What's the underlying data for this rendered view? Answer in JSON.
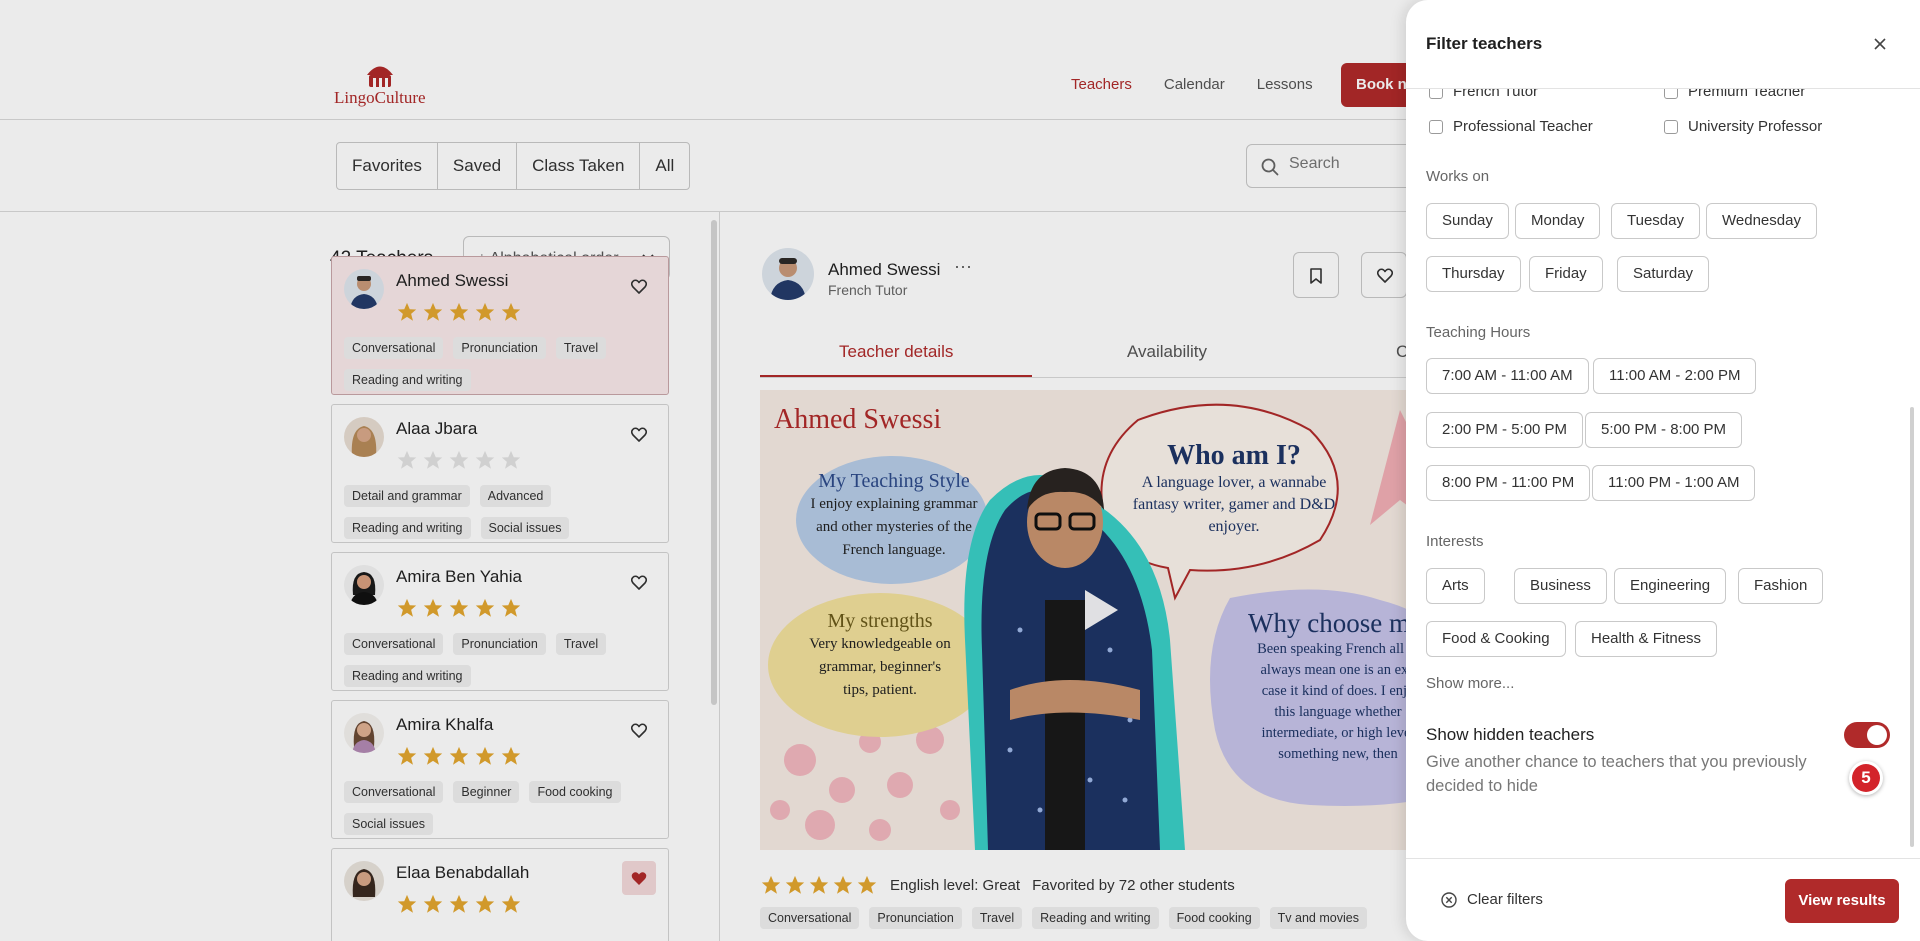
{
  "brand": {
    "name": "LingoCulture",
    "color": "#b02a2a"
  },
  "nav": {
    "teachers": "Teachers",
    "calendar": "Calendar",
    "lessons": "Lessons",
    "book_now": "Book now"
  },
  "filters_bar": {
    "favorites": "Favorites",
    "saved": "Saved",
    "class_taken": "Class Taken",
    "all": "All",
    "search_placeholder": "Search"
  },
  "list": {
    "count": "42 Teachers",
    "sort": "↓ Alphabetical order",
    "teachers": [
      {
        "name": "Ahmed Swessi",
        "rating": 5,
        "tags": [
          "Conversational",
          "Pronunciation",
          "Travel",
          "Reading and writing"
        ],
        "favorited": false,
        "selected": true
      },
      {
        "name": "Alaa Jbara",
        "rating": 0,
        "tags": [
          "Detail and grammar",
          "Advanced",
          "Reading and writing",
          "Social issues"
        ],
        "favorited": false,
        "selected": false
      },
      {
        "name": "Amira Ben Yahia",
        "rating": 5,
        "tags": [
          "Conversational",
          "Pronunciation",
          "Travel",
          "Reading and writing"
        ],
        "favorited": false,
        "selected": false
      },
      {
        "name": "Amira Khalfa",
        "rating": 5,
        "tags": [
          "Conversational",
          "Beginner",
          "Food cooking",
          "Social issues"
        ],
        "favorited": false,
        "selected": false
      },
      {
        "name": "Elaa Benabdallah",
        "rating": 5,
        "tags": [],
        "favorited": true,
        "selected": false
      }
    ]
  },
  "detail": {
    "name": "Ahmed Swessi",
    "more": "···",
    "role": "French Tutor",
    "tabs": {
      "details": "Teacher details",
      "availability": "Availability",
      "third": "C"
    },
    "video": {
      "title_name": "Ahmed Swessi",
      "style_title": "My Teaching Style",
      "style_text": [
        "I enjoy explaining grammar",
        "and other mysteries of the",
        "French language."
      ],
      "who_title": "Who am I?",
      "who_text": [
        "A language lover, a wannabe",
        "fantasy writer, gamer and D&D",
        "enjoyer."
      ],
      "strengths_title": "My strengths",
      "strengths_text": [
        "Very knowledgeable on",
        "grammar, beginner's",
        "tips, patient."
      ],
      "why_title": "Why choose me",
      "why_text": [
        "Been speaking French all m",
        "always mean one is an exp",
        "case it kind of does. I enjo",
        "this language whether",
        "intermediate, or high level",
        "something new, then"
      ]
    },
    "rating": 5,
    "english_level": "English level: Great",
    "favorited_by": "Favorited by 72 other students",
    "tags": [
      "Conversational",
      "Pronunciation",
      "Travel",
      "Reading and writing",
      "Food cooking",
      "Tv and movies"
    ]
  },
  "drawer": {
    "title": "Filter teachers",
    "roles": [
      "French Tutor",
      "Premium Teacher",
      "Professional Teacher",
      "University Professor"
    ],
    "works_on_label": "Works on",
    "days": [
      "Sunday",
      "Monday",
      "Tuesday",
      "Wednesday",
      "Thursday",
      "Friday",
      "Saturday"
    ],
    "hours_label": "Teaching Hours",
    "hours": [
      "7:00 AM - 11:00 AM",
      "11:00 AM - 2:00 PM",
      "2:00 PM - 5:00 PM",
      "5:00 PM - 8:00 PM",
      "8:00 PM - 11:00 PM",
      "11:00 PM - 1:00 AM"
    ],
    "interests_label": "Interests",
    "interests": [
      "Arts",
      "Business",
      "Engineering",
      "Fashion",
      "Food & Cooking",
      "Health & Fitness"
    ],
    "show_more": "Show more...",
    "hidden_title": "Show hidden teachers",
    "hidden_desc": "Give another chance to teachers that you previously decided to hide",
    "hidden_enabled": true,
    "badge_count": "5",
    "clear": "Clear filters",
    "view_results": "View results"
  }
}
